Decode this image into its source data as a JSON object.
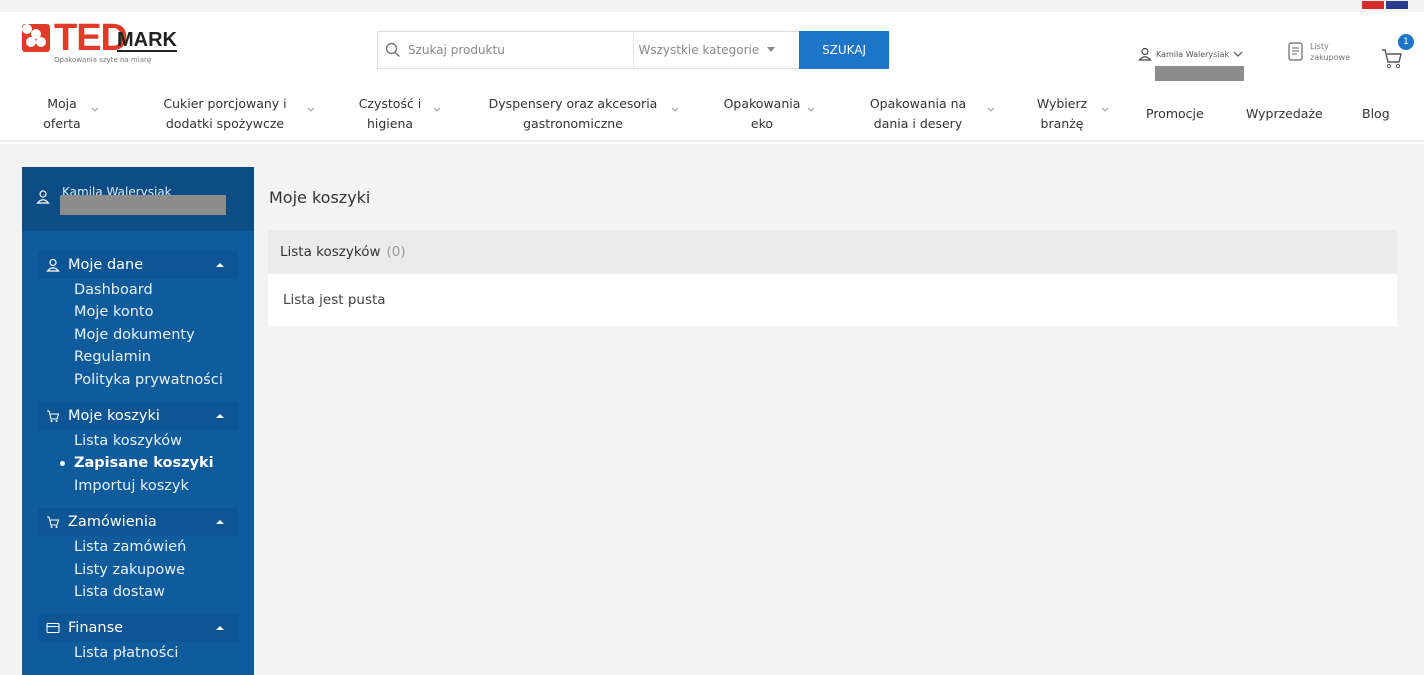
{
  "brand": {
    "name_ted": "TED",
    "name_mark": "MARK",
    "tagline": "Opakowania szyte na miarę"
  },
  "search": {
    "placeholder": "Szukaj produktu",
    "category": "Wszystkie kategorie",
    "button": "SZUKAJ"
  },
  "header": {
    "user_name": "Kamila Walerysiak",
    "lists_label": "Listy zakupowe",
    "cart_count": "1"
  },
  "nav": {
    "items": [
      "Moja oferta",
      "Cukier porcjowany i dodatki spożywcze",
      "Czystość i higiena",
      "Dyspensery oraz akcesoria gastronomiczne",
      "Opakowania eko",
      "Opakowania na dania i desery",
      "Wybierz branżę",
      "Promocje",
      "Wyprzedaże",
      "Blog"
    ]
  },
  "sidebar": {
    "user_name": "Kamila Walerysiak",
    "sections": [
      {
        "title": "Moje dane",
        "links": [
          "Dashboard",
          "Moje konto",
          "Moje dokumenty",
          "Regulamin",
          "Polityka prywatności"
        ]
      },
      {
        "title": "Moje koszyki",
        "links": [
          "Lista koszyków",
          "Zapisane koszyki",
          "Importuj koszyk"
        ],
        "active": "Zapisane koszyki"
      },
      {
        "title": "Zamówienia",
        "links": [
          "Lista zamówień",
          "Listy zakupowe",
          "Lista dostaw"
        ]
      },
      {
        "title": "Finanse",
        "links": [
          "Lista płatności"
        ]
      }
    ]
  },
  "main": {
    "title": "Moje koszyki",
    "panel_title": "Lista koszyków",
    "panel_count": "(0)",
    "empty_text": "Lista jest pusta"
  },
  "colors": {
    "brand_red": "#e03a28",
    "accent_blue": "#1d75c8",
    "sidebar_blue": "#0f5b9c"
  }
}
